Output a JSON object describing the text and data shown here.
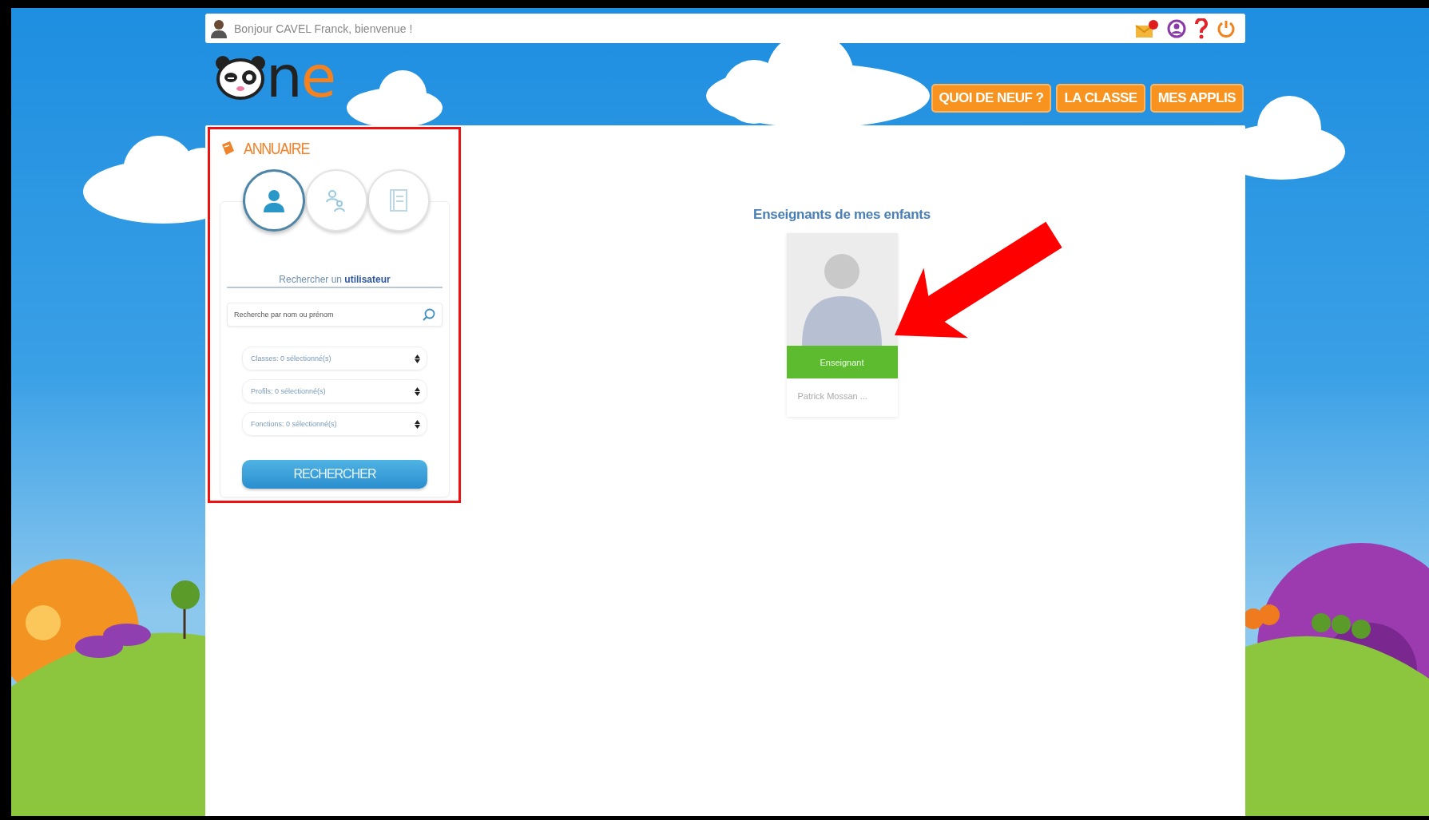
{
  "top_bar": {
    "greeting": "Bonjour CAVEL Franck, bienvenue !"
  },
  "logo": {
    "text": "ne"
  },
  "nav": [
    {
      "label": "QUOI DE NEUF ?"
    },
    {
      "label": "LA CLASSE"
    },
    {
      "label": "MES APPLIS"
    }
  ],
  "directory": {
    "title": "ANNUAIRE",
    "tabs": [
      {
        "kind": "user",
        "selected": true
      },
      {
        "kind": "group",
        "selected": false
      },
      {
        "kind": "book",
        "selected": false
      }
    ],
    "search_label": "Rechercher un **utilisateur**",
    "search": {
      "placeholder": "Recherche par nom ou prénom"
    },
    "filters": [
      {
        "value": "Classes: 0 sélectionné(s)"
      },
      {
        "value": "Profils: 0 sélectionné(s)"
      },
      {
        "value": "Fonctions: 0 sélectionné(s)"
      }
    ],
    "button": "RECHERCHER"
  },
  "teachers": {
    "heading": "Enseignants de mes enfants",
    "cards": [
      {
        "role": "Enseignant",
        "name": "Patrick Mossan ..."
      }
    ]
  }
}
